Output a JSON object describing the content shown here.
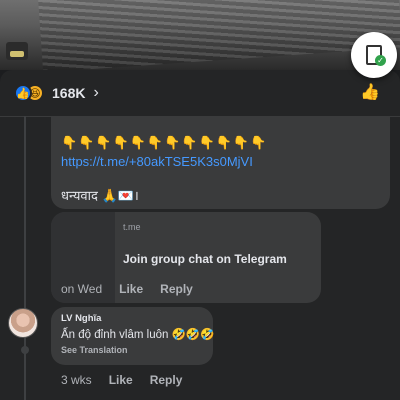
{
  "media": {
    "thumb_icon": "channel-logo-icon"
  },
  "reactions": {
    "count": "168K",
    "icons": [
      "like-reaction-icon",
      "haha-reaction-icon"
    ],
    "like_glyph": "👍",
    "haha_glyph": "😆",
    "chevron": "›",
    "thumb_glyph": "👍"
  },
  "clipboard": {
    "badge": "✓"
  },
  "comment": {
    "pointers": "👇👇👇👇👇👇👇👇👇👇👇👇",
    "link": "https://t.me/+80akTSE5K3s0MjVI",
    "thanks": "धन्यवाद 🙏💌।",
    "preview_domain": "t.me",
    "preview_title": "Join group chat on Telegram",
    "time": "on Wed",
    "like_label": "Like",
    "reply_label": "Reply"
  },
  "reply": {
    "author": "LV Nghĩa",
    "text": "Ấn độ đỉnh vlâm luôn 🤣🤣🤣",
    "translation_label": "See Translation",
    "time": "3 wks",
    "like_label": "Like",
    "reply_label": "Reply"
  },
  "colors": {
    "background": "#242526",
    "bubble": "#3a3b3c",
    "link": "#4599ff",
    "like_blue": "#1877f2"
  }
}
